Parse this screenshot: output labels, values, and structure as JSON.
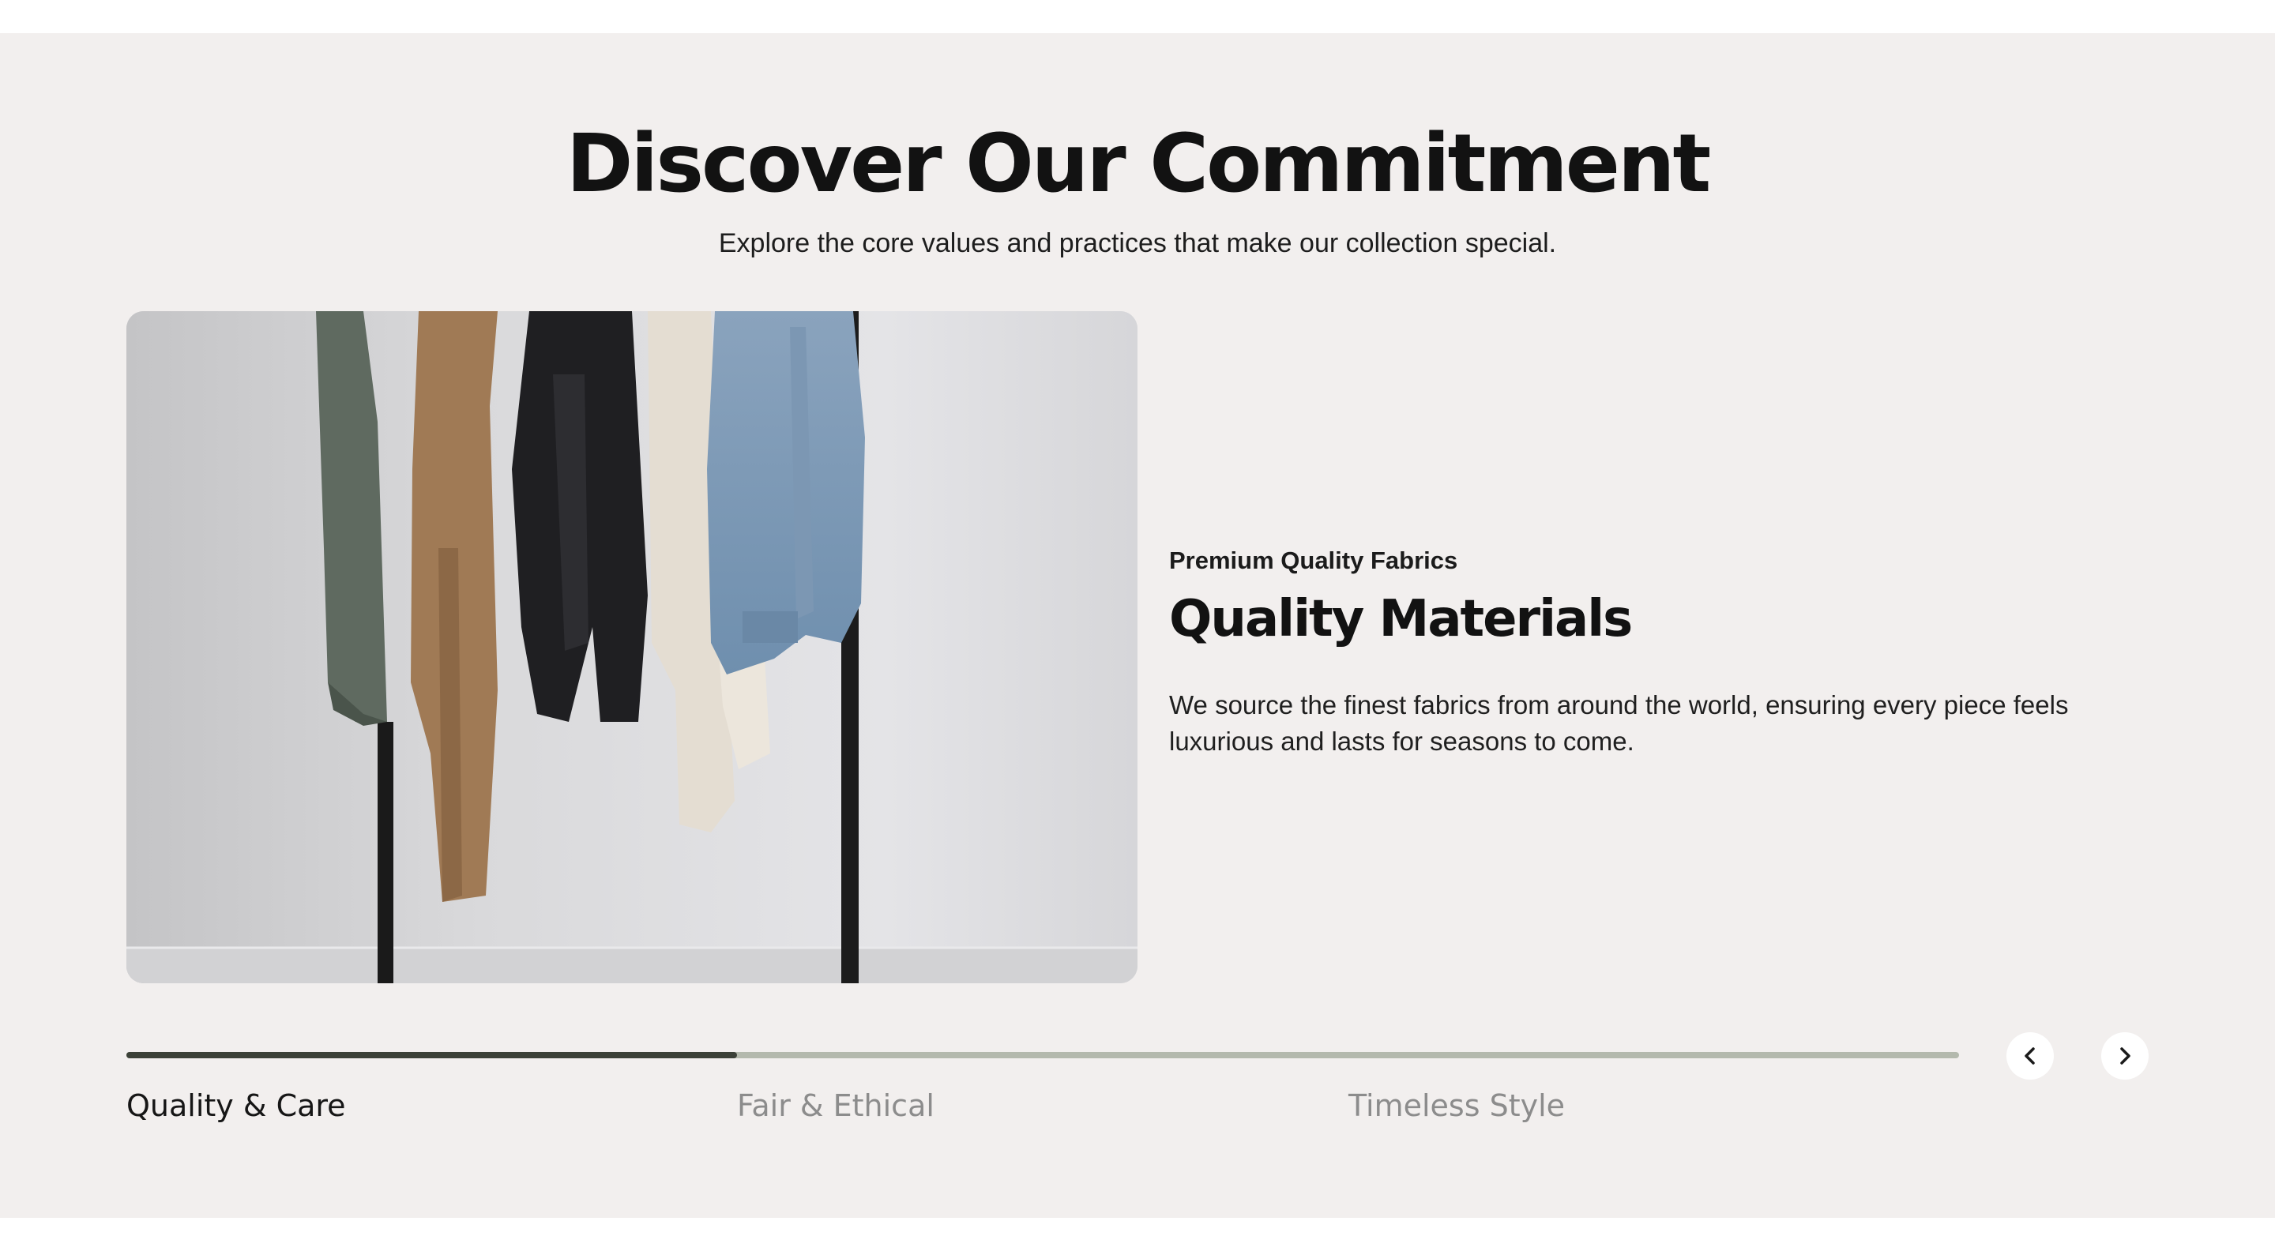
{
  "section": {
    "title": "Discover Our Commitment",
    "subtitle": "Explore the core values and practices that make our collection special."
  },
  "slide": {
    "image_alt": "Clothing rack with jackets and sweaters",
    "eyebrow": "Premium Quality Fabrics",
    "title": "Quality Materials",
    "body": "We source the finest fabrics from around the world, ensuring every piece feels luxurious and lasts for seasons to come."
  },
  "progress": {
    "fraction": 0.333
  },
  "tabs": [
    {
      "label": "Quality & Care",
      "active": true
    },
    {
      "label": "Fair & Ethical",
      "active": false
    },
    {
      "label": "Timeless Style",
      "active": false
    }
  ],
  "controls": {
    "prev_icon": "chevron-left-icon",
    "next_icon": "chevron-right-icon"
  },
  "colors": {
    "section_background": "#f2efee",
    "progress_track": "#b4b9ad",
    "progress_fill": "#3c4138",
    "tab_active": "#161616",
    "tab_inactive": "#8c8c8c"
  }
}
